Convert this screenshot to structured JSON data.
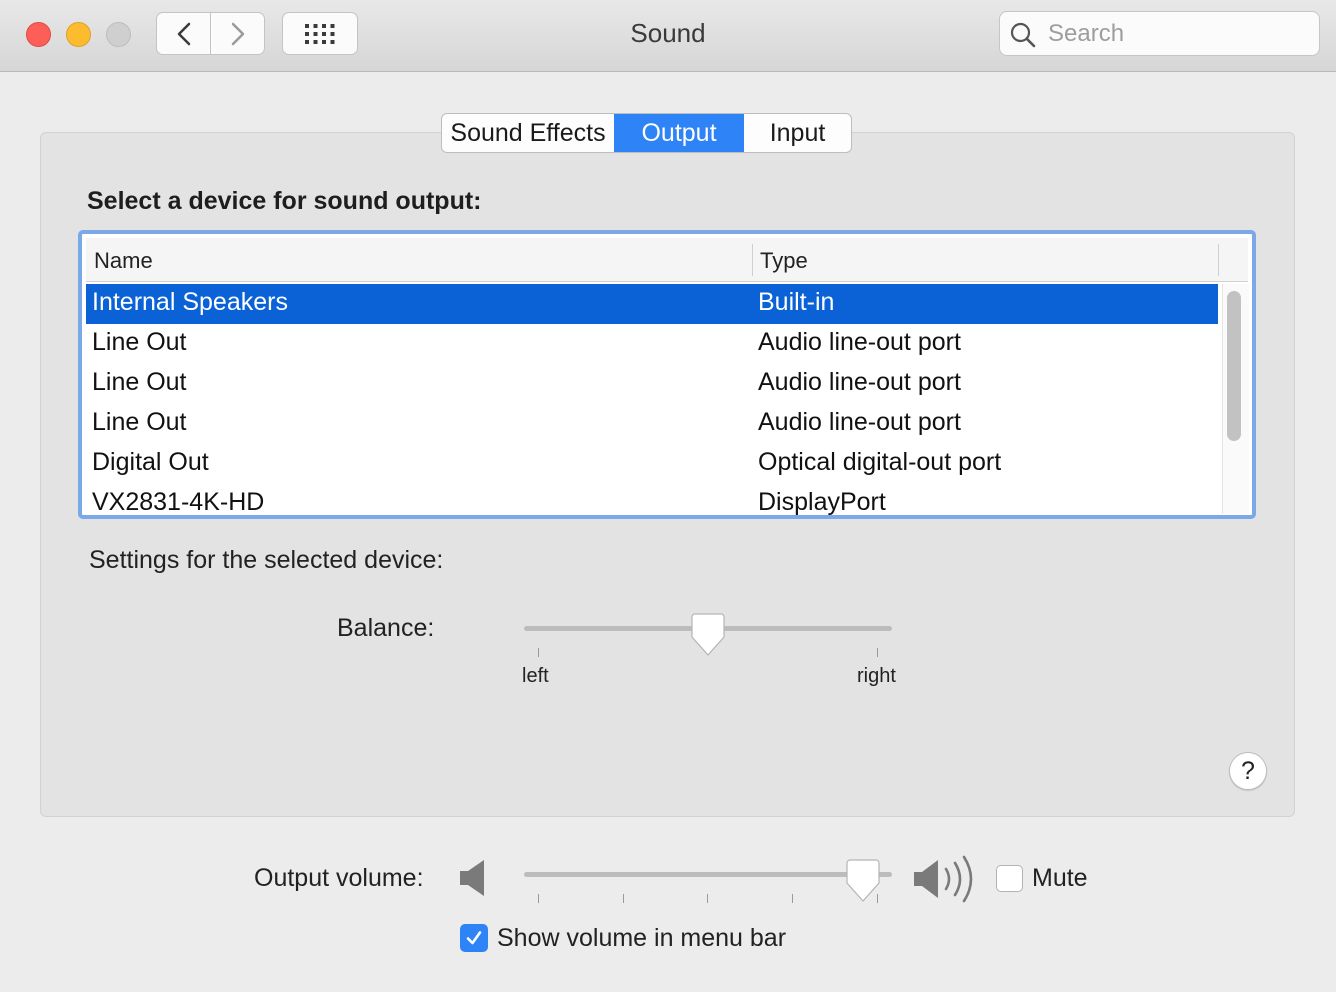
{
  "window": {
    "title": "Sound"
  },
  "search": {
    "placeholder": "Search",
    "value": ""
  },
  "tabs": [
    {
      "label": "Sound Effects",
      "active": false
    },
    {
      "label": "Output",
      "active": true
    },
    {
      "label": "Input",
      "active": false
    }
  ],
  "output": {
    "heading": "Select a device for sound output:",
    "columns": {
      "name": "Name",
      "type": "Type"
    },
    "devices": [
      {
        "name": "Internal Speakers",
        "type": "Built-in",
        "selected": true
      },
      {
        "name": "Line Out",
        "type": "Audio line-out port",
        "selected": false
      },
      {
        "name": "Line Out",
        "type": "Audio line-out port",
        "selected": false
      },
      {
        "name": "Line Out",
        "type": "Audio line-out port",
        "selected": false
      },
      {
        "name": "Digital Out",
        "type": "Optical digital-out port",
        "selected": false
      },
      {
        "name": "VX2831-4K-HD",
        "type": "DisplayPort",
        "selected": false
      }
    ],
    "settings_label": "Settings for the selected device:",
    "balance": {
      "label": "Balance:",
      "left_label": "left",
      "right_label": "right",
      "value": 0.5
    }
  },
  "help": {
    "label": "?"
  },
  "volume": {
    "label": "Output volume:",
    "value": 0.96,
    "mute_label": "Mute",
    "muted": false,
    "show_in_menu_bar_label": "Show volume in menu bar",
    "show_in_menu_bar": true
  },
  "colors": {
    "accent": "#2e83f6",
    "selection": "#0a62d6",
    "focus_ring": "#7aa8e8"
  }
}
